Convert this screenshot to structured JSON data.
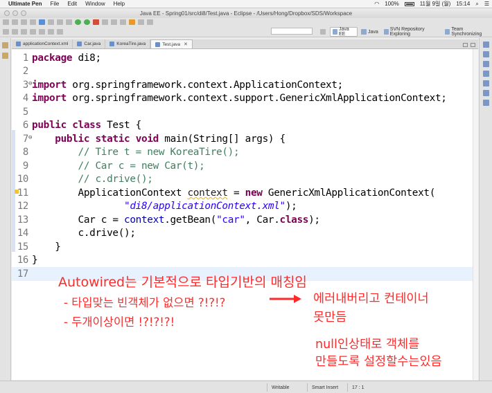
{
  "menubar": {
    "app_name": "Ultimate Pen",
    "items": [
      "File",
      "Edit",
      "Window",
      "Help"
    ],
    "battery": "100%",
    "date": "11월 9일 (월)",
    "time": "15:14"
  },
  "window": {
    "title": "Java EE - Spring01/src/di8/Test.java - Eclipse - /Users/Hong/Dropbox/SDS/Workspace"
  },
  "perspectives": [
    {
      "label": "Java EE",
      "active": true
    },
    {
      "label": "Java",
      "active": false
    },
    {
      "label": "SVN Repository Exploring",
      "active": false
    },
    {
      "label": "Team Synchronizing",
      "active": false
    }
  ],
  "tabs": [
    {
      "label": "applicationContext.xml",
      "active": false
    },
    {
      "label": "Car.java",
      "active": false
    },
    {
      "label": "KoreaTire.java",
      "active": false
    },
    {
      "label": "Test.java",
      "active": true
    }
  ],
  "code": [
    {
      "n": "1",
      "tokens": [
        {
          "t": "package",
          "c": "kw"
        },
        {
          "t": " di8;",
          "c": "code"
        }
      ]
    },
    {
      "n": "2",
      "tokens": []
    },
    {
      "n": "3",
      "marker": "⊖",
      "tokens": [
        {
          "t": "import",
          "c": "kw"
        },
        {
          "t": " org.springframework.context.ApplicationContext;",
          "c": "code"
        }
      ]
    },
    {
      "n": "4",
      "tokens": [
        {
          "t": "import",
          "c": "kw"
        },
        {
          "t": " org.springframework.context.support.GenericXmlApplicationContext;",
          "c": "code"
        }
      ]
    },
    {
      "n": "5",
      "tokens": []
    },
    {
      "n": "6",
      "tokens": [
        {
          "t": "public",
          "c": "kw"
        },
        {
          "t": " ",
          "c": "code"
        },
        {
          "t": "class",
          "c": "kw"
        },
        {
          "t": " Test {",
          "c": "code"
        }
      ]
    },
    {
      "n": "7",
      "marker": "⊖",
      "tokens": [
        {
          "t": "    ",
          "c": "code"
        },
        {
          "t": "public",
          "c": "kw"
        },
        {
          "t": " ",
          "c": "code"
        },
        {
          "t": "static",
          "c": "kw"
        },
        {
          "t": " ",
          "c": "code"
        },
        {
          "t": "void",
          "c": "kw"
        },
        {
          "t": " main(String[] args) {",
          "c": "code"
        }
      ]
    },
    {
      "n": "8",
      "tokens": [
        {
          "t": "        // Tire t = new KoreaTire();",
          "c": "cm"
        }
      ]
    },
    {
      "n": "9",
      "tokens": [
        {
          "t": "        // Car c = new Car(t);",
          "c": "cm"
        }
      ]
    },
    {
      "n": "10",
      "tokens": [
        {
          "t": "        // c.drive();",
          "c": "cm"
        }
      ]
    },
    {
      "n": "11",
      "warn": true,
      "tokens": [
        {
          "t": "        ApplicationContext ",
          "c": "code"
        },
        {
          "t": "context",
          "c": "squig"
        },
        {
          "t": " = ",
          "c": "code"
        },
        {
          "t": "new",
          "c": "kw"
        },
        {
          "t": " GenericXmlApplicationContext(",
          "c": "code"
        }
      ]
    },
    {
      "n": "12",
      "tokens": [
        {
          "t": "                ",
          "c": "code"
        },
        {
          "t": "\"di8/applicationContext.xml\"",
          "c": "st-it"
        },
        {
          "t": ");",
          "c": "code"
        }
      ]
    },
    {
      "n": "13",
      "tokens": [
        {
          "t": "        Car c = ",
          "c": "code"
        },
        {
          "t": "context",
          "c": "fld"
        },
        {
          "t": ".getBean(",
          "c": "code"
        },
        {
          "t": "\"car\"",
          "c": "st"
        },
        {
          "t": ", Car.",
          "c": "code"
        },
        {
          "t": "class",
          "c": "kw"
        },
        {
          "t": ");",
          "c": "code"
        }
      ]
    },
    {
      "n": "14",
      "tokens": [
        {
          "t": "        c.drive();",
          "c": "code"
        }
      ]
    },
    {
      "n": "15",
      "tokens": [
        {
          "t": "    }",
          "c": "code"
        }
      ]
    },
    {
      "n": "16",
      "tokens": [
        {
          "t": "}",
          "c": "code"
        }
      ]
    },
    {
      "n": "17",
      "current": true,
      "tokens": []
    }
  ],
  "annotations": {
    "line1": "Autowired는 기본적으로 타입기반의 매칭임",
    "line2": "- 타입맞는 빈객체가 없으면 ?!?!?",
    "line3": "- 두개이상이면 !?!?!?!",
    "right1": "에러내버리고 컨테이너",
    "right2": "못만듬",
    "right3": "null인상태로 객체를",
    "right4": "만들도록 설정할수는있음",
    "color": "#ff2a2a"
  },
  "status": {
    "writable": "Writable",
    "insert_mode": "Smart Insert",
    "position": "17 : 1"
  }
}
